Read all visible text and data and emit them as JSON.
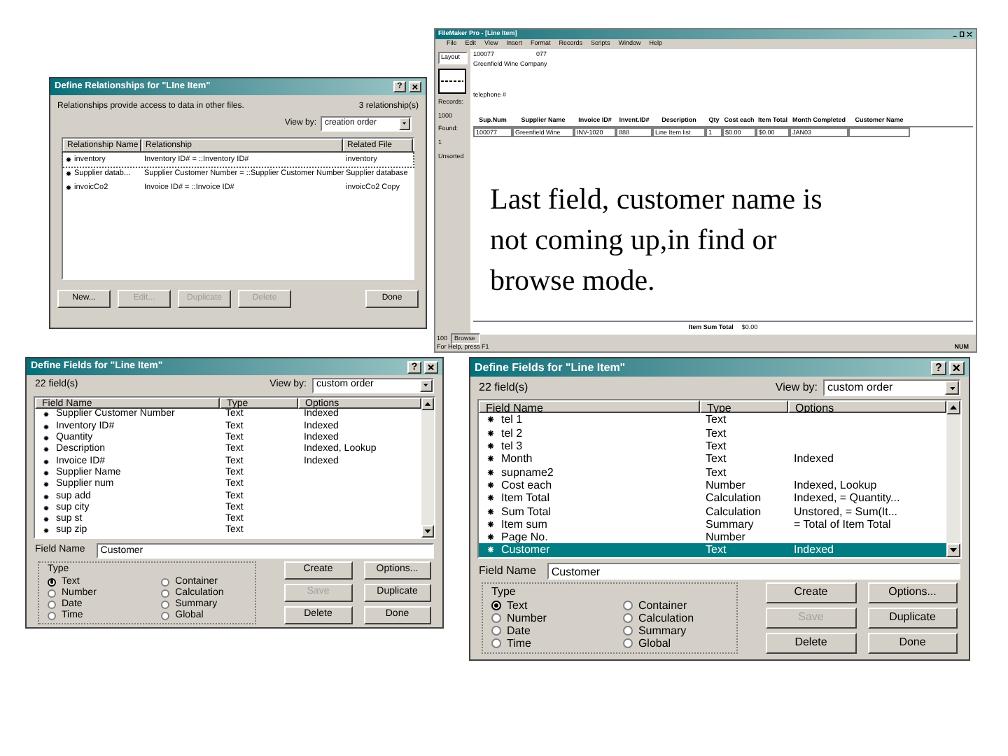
{
  "relationships_dialog": {
    "title": "Define Relationships for \"LIne Item\"",
    "help_button": "?",
    "intro": "Relationships provide access to data in other files.",
    "count": "3 relationship(s)",
    "view_by_label": "View by:",
    "view_by_value": "creation order",
    "columns": [
      "Relationship Name",
      "Relationship",
      "Related File"
    ],
    "rows": [
      {
        "name": "inventory",
        "relationship": "Inventory ID# = ::Inventory ID#",
        "related_file": "inventory",
        "selected": true
      },
      {
        "name": "Supplier datab...",
        "relationship": "Supplier Customer Number = ::Supplier Customer Number",
        "related_file": "Supplier database",
        "selected": false
      },
      {
        "name": "invoicCo2",
        "relationship": "Invoice ID# = ::Invoice ID#",
        "related_file": "invoicCo2 Copy",
        "selected": false
      }
    ],
    "buttons": [
      {
        "label": "New...",
        "disabled": false
      },
      {
        "label": "Edit...",
        "disabled": true
      },
      {
        "label": "Duplicate",
        "disabled": true
      },
      {
        "label": "Delete",
        "disabled": true
      },
      {
        "label": "Done",
        "disabled": false
      }
    ]
  },
  "filemaker_window": {
    "title": "FileMaker Pro - [Line Item]",
    "menu": [
      "File",
      "Edit",
      "View",
      "Insert",
      "Format",
      "Records",
      "Scripts",
      "Window",
      "Help"
    ],
    "status_area": {
      "layout": "Layout",
      "records_label": "Records:",
      "records": "1000",
      "found_label": "Found:",
      "found": "1",
      "sort_state": "Unsorted"
    },
    "record_id": "100077",
    "record_code": "077",
    "company": "Greenfield Wine Company",
    "telephone_label": "telephone #",
    "columns": [
      "Sup.Num",
      "Supplier Name",
      "Invoice ID#",
      "Invent.ID#",
      "Description",
      "Qty",
      "Cost each",
      "Item Total",
      "Month Completed",
      "Customer Name"
    ],
    "row": [
      "100077",
      "Greenfield Wine",
      "INV-1020",
      "888",
      "Line Item list",
      "1",
      "$0.00",
      "$0.00",
      "JAN03"
    ],
    "note": "Last field, customer name is not coming up,in find or browse mode.",
    "footer_label": "Item Sum Total",
    "footer_value": "$0.00",
    "zoom": "100",
    "mode": "Browse",
    "status_text": "For Help, press F1",
    "status_indicator": "NUM"
  },
  "fields_dialogs": [
    {
      "title": "Define Fields for \"Line Item\"",
      "help_button": "?",
      "count": "22 field(s)",
      "view_by_label": "View by:",
      "view_by_value": "custom order",
      "columns": [
        "Field Name",
        "Type",
        "Options"
      ],
      "fields": [
        {
          "name": "Supplier Customer Number",
          "type": "Text",
          "options": "Indexed",
          "selected": false
        },
        {
          "name": "Inventory ID#",
          "type": "Text",
          "options": "Indexed",
          "selected": false
        },
        {
          "name": "Quantity",
          "type": "Text",
          "options": "Indexed",
          "selected": false
        },
        {
          "name": "Description",
          "type": "Text",
          "options": "Indexed, Lookup",
          "selected": false
        },
        {
          "name": "Invoice ID#",
          "type": "Text",
          "options": "Indexed",
          "selected": false
        },
        {
          "name": "Supplier Name",
          "type": "Text",
          "selected": false
        },
        {
          "name": "Supplier num",
          "type": "Text",
          "selected": false
        },
        {
          "name": "sup add",
          "type": "Text",
          "selected": false
        },
        {
          "name": "sup city",
          "type": "Text",
          "selected": false
        },
        {
          "name": "sup st",
          "type": "Text",
          "selected": false
        },
        {
          "name": "sup zip",
          "type": "Text",
          "selected": false
        }
      ],
      "field_name_label": "Field Name",
      "field_name_value": "Customer",
      "type_legend": "Type",
      "types": [
        {
          "label": "Text",
          "selected": true
        },
        {
          "label": "Number",
          "selected": false
        },
        {
          "label": "Date",
          "selected": false
        },
        {
          "label": "Time",
          "selected": false
        },
        {
          "label": "Container",
          "selected": false
        },
        {
          "label": "Calculation",
          "selected": false
        },
        {
          "label": "Summary",
          "selected": false
        },
        {
          "label": "Global",
          "selected": false
        }
      ],
      "buttons": [
        {
          "label": "Create",
          "disabled": false
        },
        {
          "label": "Options...",
          "disabled": false
        },
        {
          "label": "Save",
          "disabled": true
        },
        {
          "label": "Duplicate",
          "disabled": false
        },
        {
          "label": "Delete",
          "disabled": false
        },
        {
          "label": "Done",
          "disabled": false
        }
      ]
    },
    {
      "title": "Define Fields for \"Line Item\"",
      "help_button": "?",
      "count": "22 field(s)",
      "view_by_label": "View by:",
      "view_by_value": "custom order",
      "columns": [
        "Field Name",
        "Type",
        "Options"
      ],
      "fields": [
        {
          "name": "tel 1",
          "type": "Text",
          "selected": false
        },
        {
          "name": "tel 2",
          "type": "Text",
          "selected": false
        },
        {
          "name": "tel 3",
          "type": "Text",
          "selected": false
        },
        {
          "name": "Month",
          "type": "Text",
          "options": "Indexed",
          "selected": false
        },
        {
          "name": "supname2",
          "type": "Text",
          "selected": false
        },
        {
          "name": "Cost each",
          "type": "Number",
          "options": "Indexed, Lookup",
          "selected": false
        },
        {
          "name": "Item Total",
          "type": "Calculation",
          "options": "Indexed, = Quantity...",
          "selected": false
        },
        {
          "name": "Sum Total",
          "type": "Calculation",
          "options": "Unstored, = Sum(It...",
          "selected": false
        },
        {
          "name": "Item sum",
          "type": "Summary",
          "options": "= Total of Item Total",
          "selected": false
        },
        {
          "name": "Page No.",
          "type": "Number",
          "selected": false
        },
        {
          "name": "Customer",
          "type": "Text",
          "options": "Indexed",
          "selected": true
        }
      ],
      "field_name_label": "Field Name",
      "field_name_value": "Customer",
      "type_legend": "Type",
      "types": [
        {
          "label": "Text",
          "selected": true
        },
        {
          "label": "Number",
          "selected": false
        },
        {
          "label": "Date",
          "selected": false
        },
        {
          "label": "Time",
          "selected": false
        },
        {
          "label": "Container",
          "selected": false
        },
        {
          "label": "Calculation",
          "selected": false
        },
        {
          "label": "Summary",
          "selected": false
        },
        {
          "label": "Global",
          "selected": false
        }
      ],
      "buttons": [
        {
          "label": "Create",
          "disabled": false
        },
        {
          "label": "Options...",
          "disabled": false
        },
        {
          "label": "Save",
          "disabled": true
        },
        {
          "label": "Duplicate",
          "disabled": false
        },
        {
          "label": "Delete",
          "disabled": false
        },
        {
          "label": "Done",
          "disabled": false
        }
      ]
    }
  ]
}
